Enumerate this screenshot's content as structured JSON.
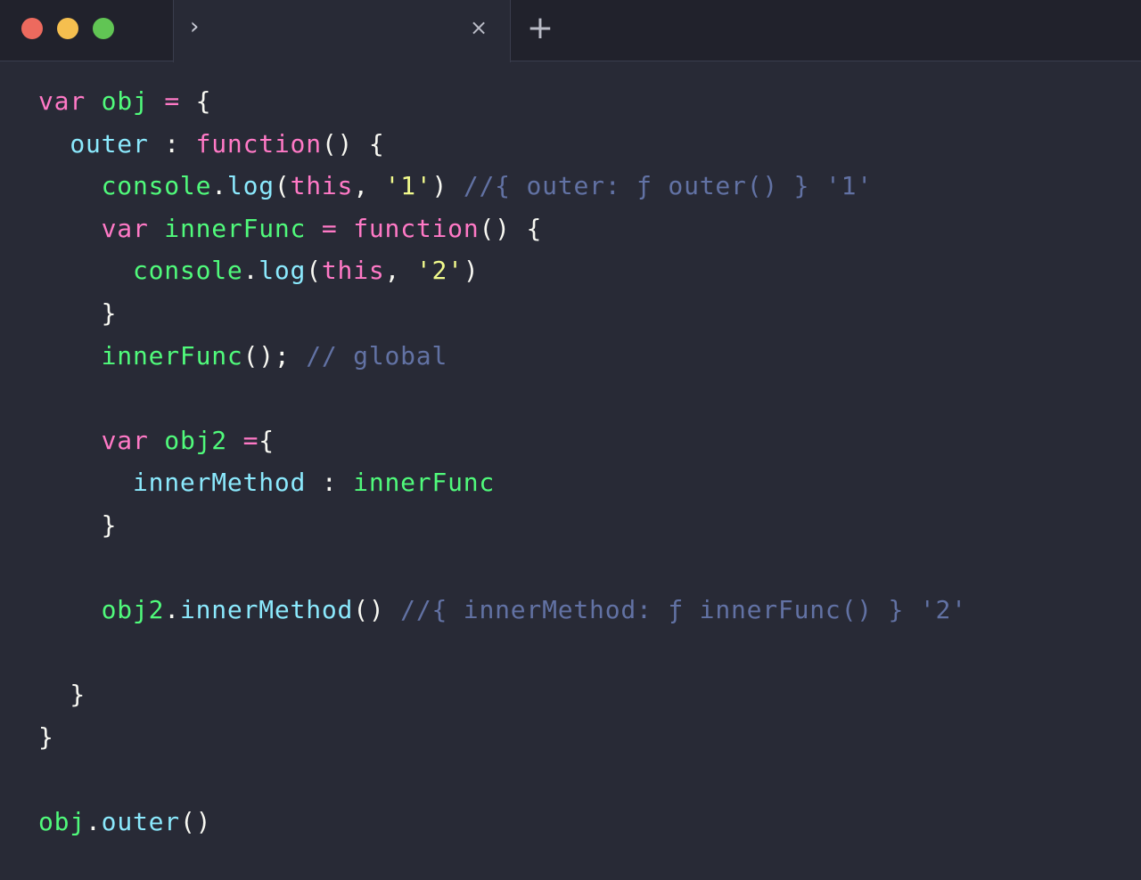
{
  "titlebar": {
    "tab": {
      "chevron_icon": "chevron-right-icon",
      "close_glyph": "×"
    },
    "add_tab_glyph": "+"
  },
  "colors": {
    "background": "#282a36",
    "keyword": "#ff79c6",
    "function_name": "#50fa7b",
    "property": "#8be9fd",
    "string": "#f1fa8c",
    "comment": "#6272a4",
    "plain": "#f8f8f2"
  },
  "code_lines": [
    [
      [
        "kw",
        "var"
      ],
      [
        "pun",
        " "
      ],
      [
        "def",
        "obj"
      ],
      [
        "pun",
        " "
      ],
      [
        "kw",
        "="
      ],
      [
        "pun",
        " {"
      ]
    ],
    [
      [
        "pun",
        "  "
      ],
      [
        "prop",
        "outer"
      ],
      [
        "pun",
        " : "
      ],
      [
        "fn",
        "function"
      ],
      [
        "pun",
        "() {"
      ]
    ],
    [
      [
        "pun",
        "    "
      ],
      [
        "def",
        "console"
      ],
      [
        "pun",
        "."
      ],
      [
        "prop",
        "log"
      ],
      [
        "pun",
        "("
      ],
      [
        "this",
        "this"
      ],
      [
        "pun",
        ", "
      ],
      [
        "str",
        "'1'"
      ],
      [
        "pun",
        ") "
      ],
      [
        "cmt",
        "//{ outer: ƒ outer() } '1'"
      ]
    ],
    [
      [
        "pun",
        "    "
      ],
      [
        "kw",
        "var"
      ],
      [
        "pun",
        " "
      ],
      [
        "def",
        "innerFunc"
      ],
      [
        "pun",
        " "
      ],
      [
        "kw",
        "="
      ],
      [
        "pun",
        " "
      ],
      [
        "fn",
        "function"
      ],
      [
        "pun",
        "() {"
      ]
    ],
    [
      [
        "pun",
        "      "
      ],
      [
        "def",
        "console"
      ],
      [
        "pun",
        "."
      ],
      [
        "prop",
        "log"
      ],
      [
        "pun",
        "("
      ],
      [
        "this",
        "this"
      ],
      [
        "pun",
        ", "
      ],
      [
        "str",
        "'2'"
      ],
      [
        "pun",
        ")"
      ]
    ],
    [
      [
        "pun",
        "    }"
      ]
    ],
    [
      [
        "pun",
        "    "
      ],
      [
        "def",
        "innerFunc"
      ],
      [
        "pun",
        "(); "
      ],
      [
        "cmt",
        "// global"
      ]
    ],
    [],
    [
      [
        "pun",
        "    "
      ],
      [
        "kw",
        "var"
      ],
      [
        "pun",
        " "
      ],
      [
        "def",
        "obj2"
      ],
      [
        "pun",
        " "
      ],
      [
        "kw",
        "="
      ],
      [
        "pun",
        "{"
      ]
    ],
    [
      [
        "pun",
        "      "
      ],
      [
        "prop",
        "innerMethod"
      ],
      [
        "pun",
        " : "
      ],
      [
        "ident",
        "innerFunc"
      ]
    ],
    [
      [
        "pun",
        "    }"
      ]
    ],
    [],
    [
      [
        "pun",
        "    "
      ],
      [
        "def",
        "obj2"
      ],
      [
        "pun",
        "."
      ],
      [
        "prop",
        "innerMethod"
      ],
      [
        "pun",
        "() "
      ],
      [
        "cmt",
        "//{ innerMethod: ƒ innerFunc() } '2'"
      ]
    ],
    [],
    [
      [
        "pun",
        "  }"
      ]
    ],
    [
      [
        "pun",
        "}"
      ]
    ],
    [],
    [
      [
        "def",
        "obj"
      ],
      [
        "pun",
        "."
      ],
      [
        "prop",
        "outer"
      ],
      [
        "pun",
        "()"
      ]
    ]
  ]
}
